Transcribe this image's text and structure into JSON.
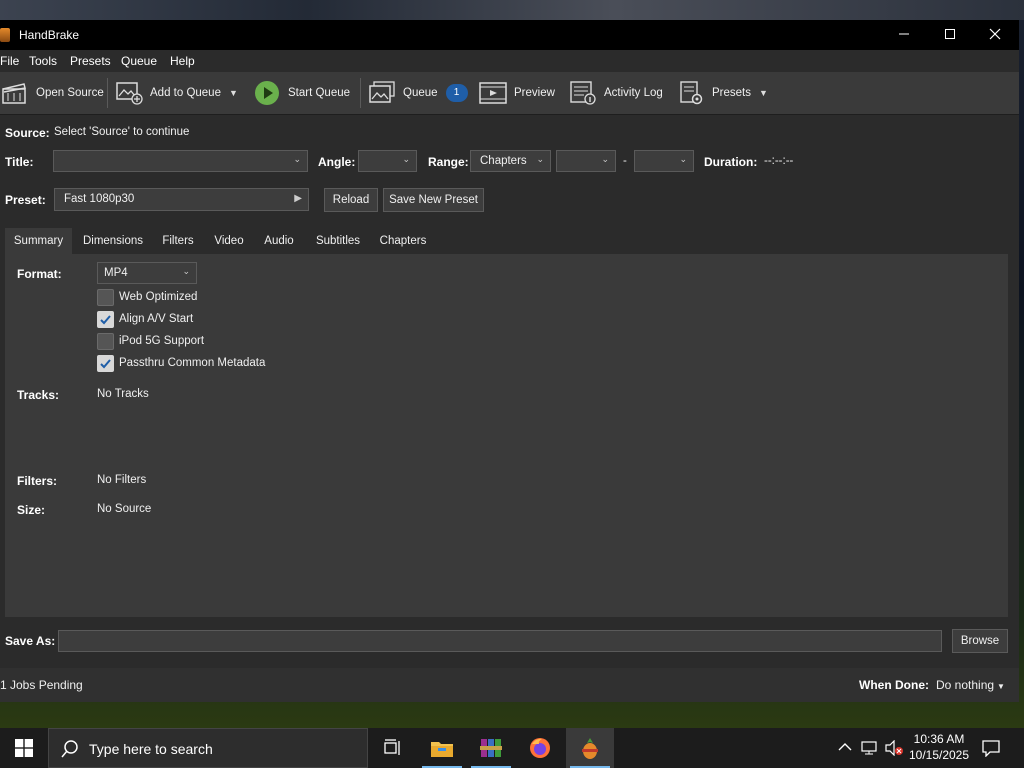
{
  "window": {
    "title": "HandBrake"
  },
  "menu": [
    "File",
    "Tools",
    "Presets",
    "Queue",
    "Help"
  ],
  "toolbar": {
    "open_source": "Open Source",
    "add_to_queue": "Add to Queue",
    "start_queue": "Start Queue",
    "queue": "Queue",
    "queue_count": "1",
    "preview": "Preview",
    "activity_log": "Activity Log",
    "presets": "Presets"
  },
  "source": {
    "label": "Source:",
    "value": "Select 'Source' to continue"
  },
  "title_row": {
    "title_label": "Title:",
    "title_value": "",
    "angle_label": "Angle:",
    "angle_value": "",
    "range_label": "Range:",
    "range_value": "Chapters",
    "range_start": "",
    "range_dash": "-",
    "range_end": "",
    "duration_label": "Duration:",
    "duration_value": "--:--:--"
  },
  "preset_row": {
    "label": "Preset:",
    "value": "Fast 1080p30",
    "reload": "Reload",
    "save_new": "Save New Preset"
  },
  "tabs": [
    "Summary",
    "Dimensions",
    "Filters",
    "Video",
    "Audio",
    "Subtitles",
    "Chapters"
  ],
  "active_tab": "Summary",
  "summary": {
    "format_label": "Format:",
    "format_value": "MP4",
    "options": [
      {
        "label": "Web Optimized",
        "checked": false
      },
      {
        "label": "Align A/V Start",
        "checked": true
      },
      {
        "label": "iPod 5G Support",
        "checked": false
      },
      {
        "label": "Passthru Common Metadata",
        "checked": true
      }
    ],
    "tracks_label": "Tracks:",
    "tracks_value": "No Tracks",
    "filters_label": "Filters:",
    "filters_value": "No Filters",
    "size_label": "Size:",
    "size_value": "No Source"
  },
  "save_as": {
    "label": "Save As:",
    "value": "",
    "browse": "Browse"
  },
  "status": {
    "jobs_pending": "1 Jobs Pending",
    "when_done_label": "When Done:",
    "when_done_value": "Do nothing"
  },
  "taskbar": {
    "search_placeholder": "Type here to search",
    "time": "10:36 AM",
    "date": "10/15/2025"
  },
  "colors": {
    "accent": "#1f5ea8",
    "window_bg": "#2b2b2b",
    "panel_bg": "#3a3a3a",
    "play_green": "#6ab04c"
  }
}
